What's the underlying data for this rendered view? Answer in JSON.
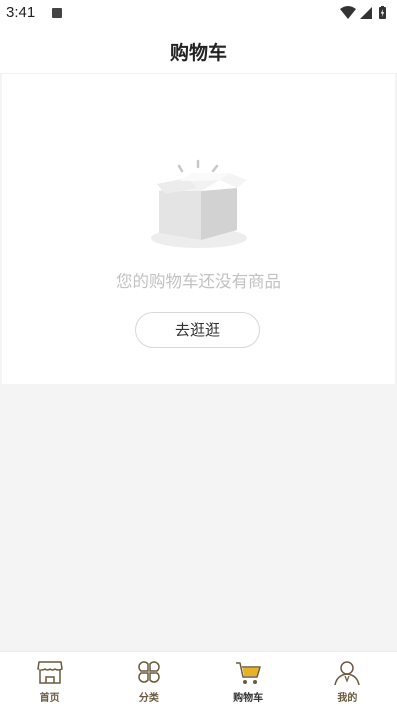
{
  "status_bar": {
    "time": "3:41",
    "icons": [
      "a-notification-icon",
      "wifi-icon",
      "signal-icon",
      "battery-icon"
    ]
  },
  "header": {
    "title": "购物车"
  },
  "empty_state": {
    "message": "您的购物车还没有商品",
    "button_label": "去逛逛",
    "illustration": "empty-box-icon"
  },
  "tab_bar": {
    "tabs": [
      {
        "label": "首页",
        "icon": "home-store-icon",
        "active": false
      },
      {
        "label": "分类",
        "icon": "category-icon",
        "active": false
      },
      {
        "label": "购物车",
        "icon": "cart-icon",
        "active": true
      },
      {
        "label": "我的",
        "icon": "profile-icon",
        "active": false
      }
    ],
    "accent_color": "#e6b325",
    "icon_color": "#6b5a3e"
  }
}
